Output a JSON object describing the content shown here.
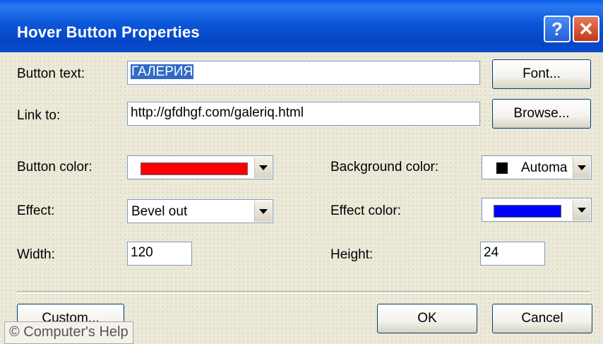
{
  "window": {
    "title": "Hover Button Properties",
    "help_glyph": "?",
    "close_glyph": "✕"
  },
  "fields": {
    "button_text_label": "Button text:",
    "button_text_value": "ГАЛЕРИЯ",
    "link_to_label": "Link to:",
    "link_to_value": "http://gfdhgf.com/galeriq.html",
    "button_color_label": "Button color:",
    "button_color_value": "#ff0000",
    "background_color_label": "Background color:",
    "background_color_value": "Automa",
    "background_color_swatch": "#000000",
    "effect_label": "Effect:",
    "effect_value": "Bevel out",
    "effect_color_label": "Effect color:",
    "effect_color_value": "#0000ff",
    "width_label": "Width:",
    "width_value": "120",
    "height_label": "Height:",
    "height_value": "24"
  },
  "buttons": {
    "font": "Font...",
    "browse": "Browse...",
    "custom": "Custom...",
    "ok": "OK",
    "cancel": "Cancel"
  },
  "watermark": "© Computer's Help",
  "colors": {
    "titlebar": "#0a56d6",
    "dialog_bg": "#ece9d8"
  }
}
